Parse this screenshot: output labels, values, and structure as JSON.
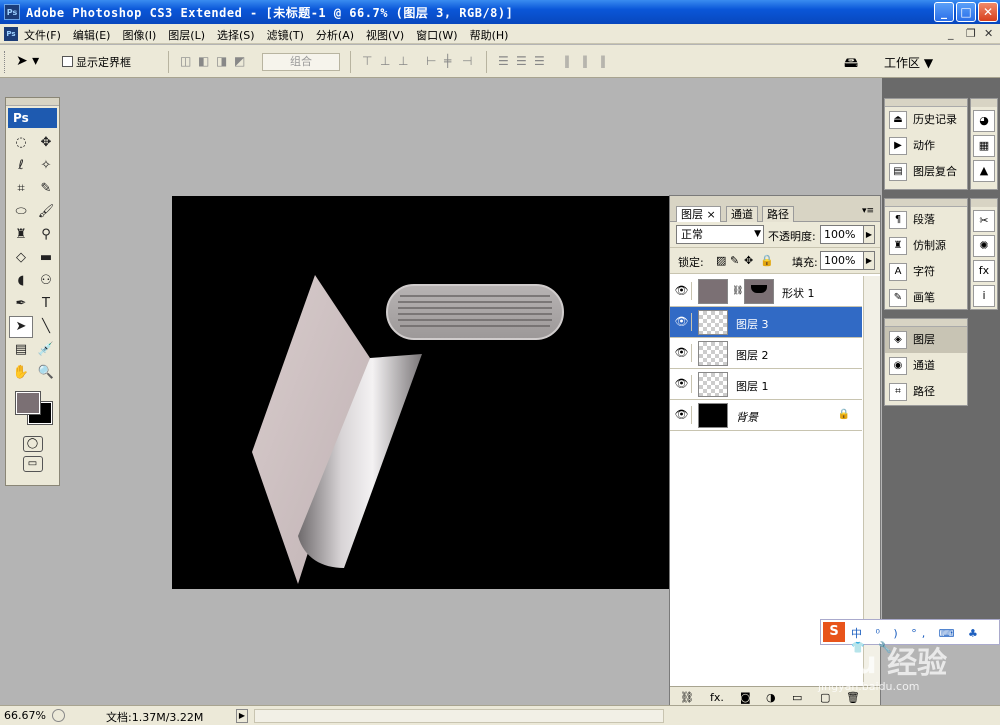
{
  "window": {
    "title": "Adobe Photoshop CS3 Extended - [未标题-1 @ 66.7% (图层 3, RGB/8)]",
    "app_icon": "Ps",
    "minimize": "_",
    "maximize": "□",
    "close": "✕"
  },
  "menu": {
    "items": [
      "文件(F)",
      "编辑(E)",
      "图像(I)",
      "图层(L)",
      "选择(S)",
      "滤镜(T)",
      "分析(A)",
      "视图(V)",
      "窗口(W)",
      "帮助(H)"
    ],
    "mdi_min": "_",
    "mdi_max": "❐",
    "mdi_close": "✕"
  },
  "options": {
    "tool_icon": "arrow-select-icon",
    "show_bounding_box": "显示定界框",
    "combine": "组合",
    "workspace": "工作区 ▼"
  },
  "tools": {
    "logo": "Ps",
    "fg_color": "#7b7074",
    "bg_color": "#000000"
  },
  "layers_panel": {
    "tabs": [
      "图层",
      "通道",
      "路径"
    ],
    "tab_close": "×",
    "blend_mode": "正常",
    "opacity_label": "不透明度:",
    "opacity": "100%",
    "lock_label": "锁定:",
    "fill_label": "填充:",
    "fill": "100%",
    "layers": [
      {
        "name": "形状 1",
        "type": "shape",
        "selected": false
      },
      {
        "name": "图层 3",
        "type": "pixel",
        "selected": true
      },
      {
        "name": "图层 2",
        "type": "pixel",
        "selected": false
      },
      {
        "name": "图层 1",
        "type": "pixel",
        "selected": false
      },
      {
        "name": "背景",
        "type": "background",
        "selected": false
      }
    ]
  },
  "right_panels": {
    "group1": [
      "历史记录",
      "动作",
      "图层复合"
    ],
    "group2": [
      "段落",
      "仿制源",
      "字符",
      "画笔"
    ],
    "group3": [
      "图层",
      "通道",
      "路径"
    ]
  },
  "ime": {
    "logo": "S",
    "items": "中 ⁰ ) °, ⌨ ♣ 👕 🔧"
  },
  "watermark": {
    "main": "Bai du 经验",
    "sub": "jingyan.baidu.com"
  },
  "status": {
    "zoom": "66.67%",
    "doc": "文档:1.37M/3.22M"
  }
}
